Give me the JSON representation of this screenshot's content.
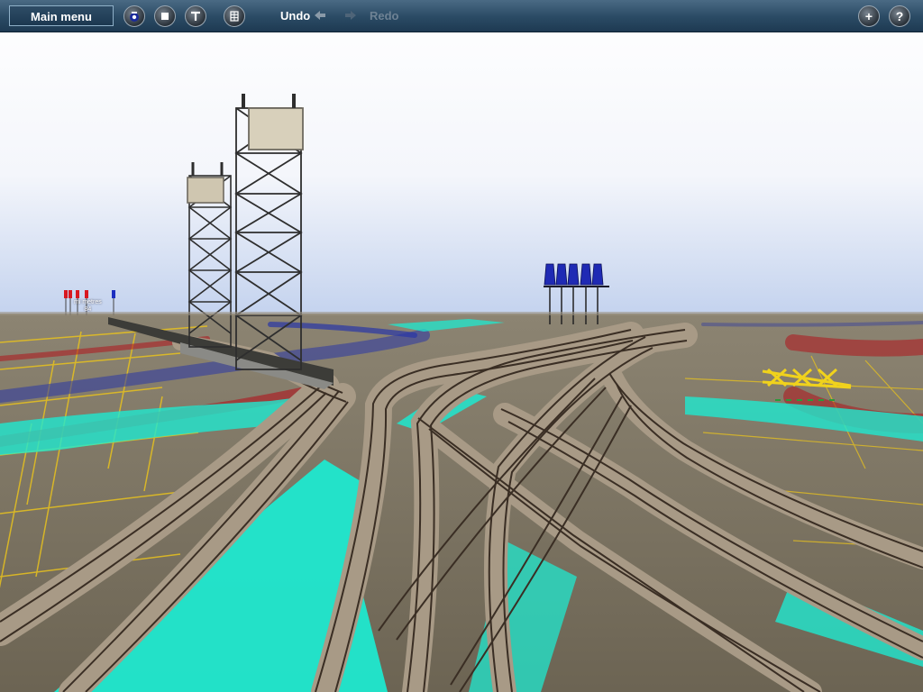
{
  "toolbar": {
    "main_menu_label": "Main menu",
    "undo_label": "Undo",
    "redo_label": "Redo",
    "icons": {
      "camera": "camera-icon",
      "stop": "stop-icon",
      "info": "info-icon",
      "grid": "grid-icon",
      "add": "plus-icon",
      "help": "help-icon"
    },
    "help_glyph": "?",
    "add_glyph": "+"
  },
  "scene": {
    "signal_label_line1": "mi  metres",
    "signal_label_line2": "84"
  },
  "colors": {
    "sky_top": "#ffffff",
    "sky_horizon": "#c8d6ee",
    "ground": "#7c7463",
    "water_overlay": "#1fe8cf",
    "height_overlay_red": "#b0141c",
    "height_overlay_blue": "#2a36a6",
    "grid_line": "#e8c21e",
    "rail": "#3a2e24",
    "ballast": "#a89a86"
  }
}
